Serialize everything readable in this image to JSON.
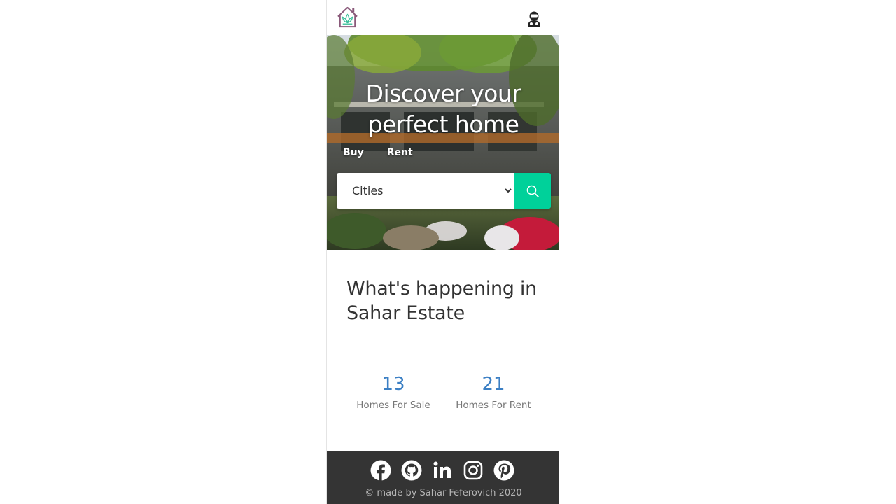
{
  "hero": {
    "title_line1": "Discover your",
    "title_line2": "perfect home",
    "tabs": [
      {
        "label": "Buy"
      },
      {
        "label": "Rent"
      }
    ]
  },
  "search": {
    "select_value": "Cities",
    "options": [
      "Cities"
    ],
    "button_icon": "search-icon",
    "accent_color": "#00d19a"
  },
  "stats": {
    "title": "What's happening in Sahar Estate",
    "items": [
      {
        "number": "13",
        "label": "Homes For Sale"
      },
      {
        "number": "21",
        "label": "Homes For Rent"
      }
    ],
    "number_color": "#3b7fc4"
  },
  "footer": {
    "socials": [
      "facebook-icon",
      "github-icon",
      "linkedin-icon",
      "instagram-icon",
      "pinterest-icon"
    ],
    "copyright": "© made by Sahar Feferovich 2020",
    "background": "#343434"
  },
  "nav": {
    "logo_icon": "house-lotus-logo",
    "user_icon": "user-icon"
  }
}
